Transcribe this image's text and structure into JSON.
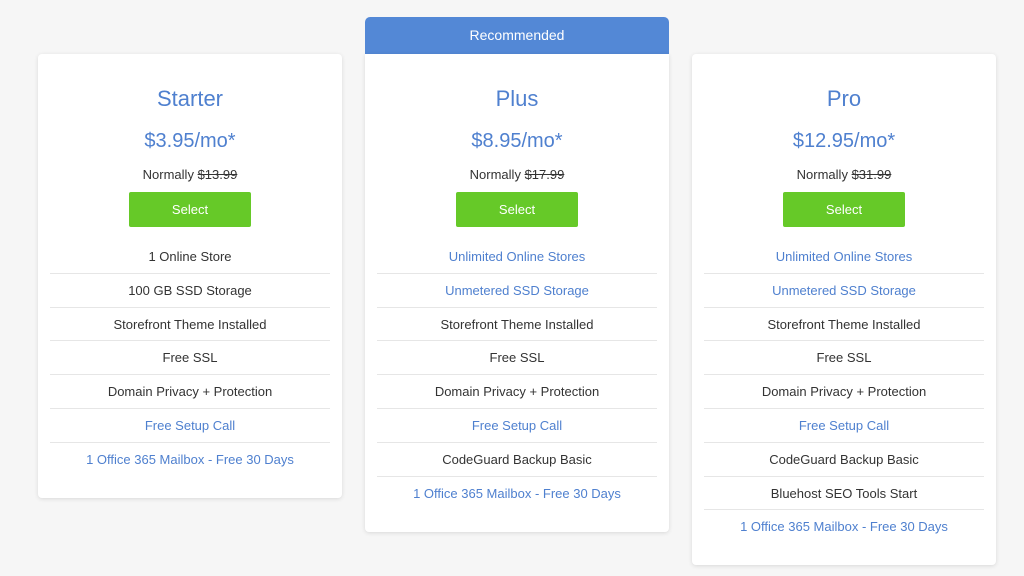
{
  "recommended_label": "Recommended",
  "colors": {
    "accent_blue": "#4f80cf",
    "banner_blue": "#5388d6",
    "select_green": "#66c928"
  },
  "plans": [
    {
      "name": "Starter",
      "price": "$3.95/mo*",
      "normally_label": "Normally",
      "normal_price": "$13.99",
      "select_label": "Select",
      "features": [
        {
          "text": "1 Online Store",
          "highlight": false
        },
        {
          "text": "100 GB SSD Storage",
          "highlight": false
        },
        {
          "text": "Storefront Theme Installed",
          "highlight": false
        },
        {
          "text": "Free SSL",
          "highlight": false
        },
        {
          "text": "Domain Privacy + Protection",
          "highlight": false
        },
        {
          "text": "Free Setup Call",
          "highlight": true
        },
        {
          "text": "1 Office 365 Mailbox - Free 30 Days",
          "highlight": true
        }
      ]
    },
    {
      "name": "Plus",
      "price": "$8.95/mo*",
      "normally_label": "Normally",
      "normal_price": "$17.99",
      "select_label": "Select",
      "features": [
        {
          "text": "Unlimited Online Stores",
          "highlight": true
        },
        {
          "text": "Unmetered SSD Storage",
          "highlight": true
        },
        {
          "text": "Storefront Theme Installed",
          "highlight": false
        },
        {
          "text": "Free SSL",
          "highlight": false
        },
        {
          "text": "Domain Privacy + Protection",
          "highlight": false
        },
        {
          "text": "Free Setup Call",
          "highlight": true
        },
        {
          "text": "CodeGuard Backup Basic",
          "highlight": false
        },
        {
          "text": "1 Office 365 Mailbox - Free 30 Days",
          "highlight": true
        }
      ]
    },
    {
      "name": "Pro",
      "price": "$12.95/mo*",
      "normally_label": "Normally",
      "normal_price": "$31.99",
      "select_label": "Select",
      "features": [
        {
          "text": "Unlimited Online Stores",
          "highlight": true
        },
        {
          "text": "Unmetered SSD Storage",
          "highlight": true
        },
        {
          "text": "Storefront Theme Installed",
          "highlight": false
        },
        {
          "text": "Free SSL",
          "highlight": false
        },
        {
          "text": "Domain Privacy + Protection",
          "highlight": false
        },
        {
          "text": "Free Setup Call",
          "highlight": true
        },
        {
          "text": "CodeGuard Backup Basic",
          "highlight": false
        },
        {
          "text": "Bluehost SEO Tools Start",
          "highlight": false
        },
        {
          "text": "1 Office 365 Mailbox - Free 30 Days",
          "highlight": true
        }
      ]
    }
  ]
}
